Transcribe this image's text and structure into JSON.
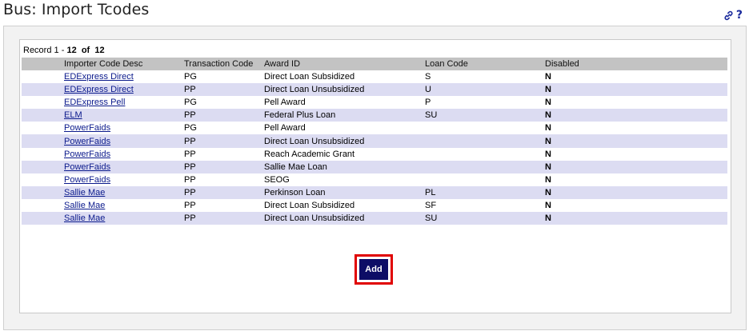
{
  "page": {
    "title": "Bus: Import Tcodes"
  },
  "icons": {
    "link": "link-icon",
    "help": "?"
  },
  "records": {
    "prefix": "Record",
    "start": "1",
    "end": "12",
    "of_label": "of",
    "total": "12"
  },
  "table": {
    "headers": [
      "Importer Code Desc",
      "Transaction Code",
      "Award ID",
      "Loan Code",
      "Disabled"
    ],
    "rows": [
      {
        "importer": "EDExpress Direct",
        "tcode": "PG",
        "award": "Direct Loan Subsidized",
        "loan": "S",
        "disabled": "N"
      },
      {
        "importer": "EDExpress Direct",
        "tcode": "PP",
        "award": "Direct Loan Unsubsidized",
        "loan": "U",
        "disabled": "N"
      },
      {
        "importer": "EDExpress Pell",
        "tcode": "PG",
        "award": "Pell Award",
        "loan": "P",
        "disabled": "N"
      },
      {
        "importer": "ELM",
        "tcode": "PP",
        "award": "Federal Plus Loan",
        "loan": "SU",
        "disabled": "N"
      },
      {
        "importer": "PowerFaids",
        "tcode": "PG",
        "award": "Pell Award",
        "loan": "",
        "disabled": "N"
      },
      {
        "importer": "PowerFaids",
        "tcode": "PP",
        "award": "Direct Loan Unsubsidized",
        "loan": "",
        "disabled": "N"
      },
      {
        "importer": "PowerFaids",
        "tcode": "PP",
        "award": "Reach Academic Grant",
        "loan": "",
        "disabled": "N"
      },
      {
        "importer": "PowerFaids",
        "tcode": "PP",
        "award": "Sallie Mae Loan",
        "loan": "",
        "disabled": "N"
      },
      {
        "importer": "PowerFaids",
        "tcode": "PP",
        "award": "SEOG",
        "loan": "",
        "disabled": "N"
      },
      {
        "importer": "Sallie Mae",
        "tcode": "PP",
        "award": "Perkinson Loan",
        "loan": "PL",
        "disabled": "N"
      },
      {
        "importer": "Sallie Mae",
        "tcode": "PP",
        "award": "Direct Loan Subsidized",
        "loan": "SF",
        "disabled": "N"
      },
      {
        "importer": "Sallie Mae",
        "tcode": "PP",
        "award": "Direct Loan Unsubsidized",
        "loan": "SU",
        "disabled": "N"
      }
    ]
  },
  "actions": {
    "add_label": "Add"
  },
  "colors": {
    "header_bg": "#c3c3c3",
    "alt_row_bg": "#dcdcf2",
    "link": "#0b1a8c",
    "button_bg": "#0d0d66",
    "highlight_border": "#e00000"
  }
}
